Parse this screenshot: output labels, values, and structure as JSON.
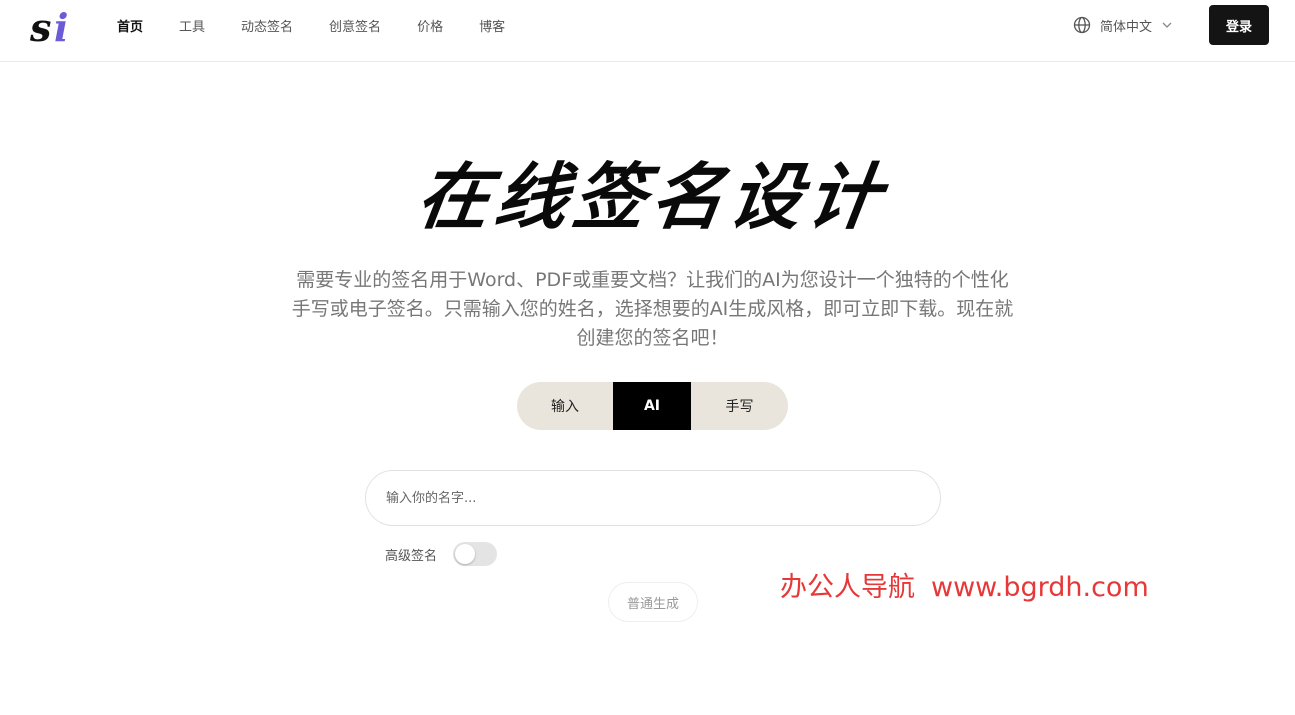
{
  "header": {
    "logo_text": "si",
    "nav": [
      {
        "label": "首页",
        "active": true
      },
      {
        "label": "工具",
        "active": false
      },
      {
        "label": "动态签名",
        "active": false
      },
      {
        "label": "创意签名",
        "active": false
      },
      {
        "label": "价格",
        "active": false
      },
      {
        "label": "博客",
        "active": false
      }
    ],
    "language": "简体中文",
    "language_icon": "globe-icon",
    "dropdown_icon": "chevron-down-icon",
    "login_label": "登录"
  },
  "hero": {
    "title": "在线签名设计",
    "subtitle_lines": [
      "需要专业的签名用于Word、PDF或重要文档？让我们的AI为您设计一个独特的个性化",
      "手写或电子签名。只需输入您的姓名，选择想要的AI生成风格，即可立即下载。现在就",
      "创建您的签名吧！"
    ]
  },
  "tabs": [
    {
      "label": "输入",
      "active": false
    },
    {
      "label": "AI",
      "active": true
    },
    {
      "label": "手写",
      "active": false
    }
  ],
  "form": {
    "name_placeholder": "输入你的名字...",
    "name_value": "",
    "advanced_label": "高级签名",
    "advanced_enabled": false,
    "generate_label": "普通生成"
  },
  "watermark": {
    "text": "办公人导航",
    "url": "www.bgrdh.com"
  },
  "colors": {
    "accent_dark": "#141414",
    "tab_bg": "#e9e5dc",
    "logo_i": "#6b5bd6",
    "watermark": "#e63838"
  }
}
